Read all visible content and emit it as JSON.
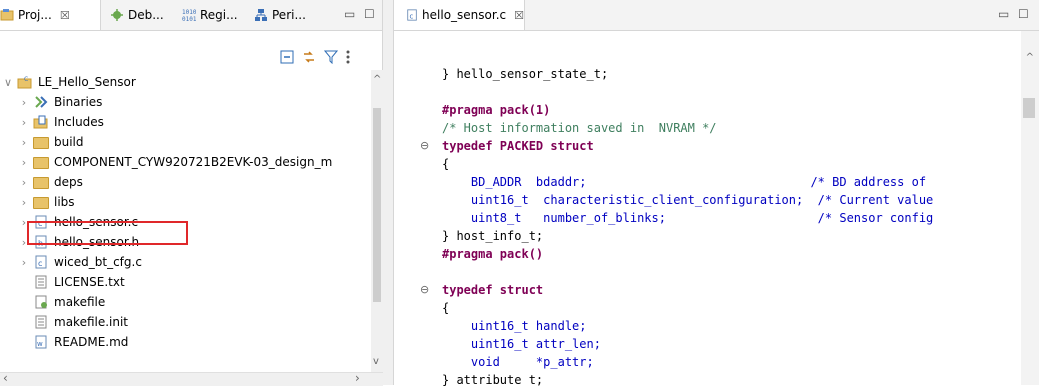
{
  "left_tabs": [
    {
      "label": "Proj...",
      "icon": "project-explorer-icon",
      "close": "☒"
    },
    {
      "label": "Deb...",
      "icon": "debug-icon"
    },
    {
      "label": "Regi...",
      "icon": "registers-icon"
    },
    {
      "label": "Peri...",
      "icon": "peripherals-icon"
    }
  ],
  "editor_tab": {
    "label": "hello_sensor.c",
    "close": "☒"
  },
  "tree": {
    "project": "LE_Hello_Sensor",
    "items": [
      {
        "label": "Binaries",
        "icon": "binaries-icon"
      },
      {
        "label": "Includes",
        "icon": "includes-icon"
      },
      {
        "label": "build",
        "icon": "folder-icon"
      },
      {
        "label": "COMPONENT_CYW920721B2EVK-03_design_m",
        "icon": "folder-icon"
      },
      {
        "label": "deps",
        "icon": "folder-icon"
      },
      {
        "label": "libs",
        "icon": "folder-icon"
      },
      {
        "label": "hello_sensor.c",
        "icon": "c-file-icon"
      },
      {
        "label": "hello_sensor.h",
        "icon": "h-file-icon"
      },
      {
        "label": "wiced_bt_cfg.c",
        "icon": "c-file-icon"
      },
      {
        "label": "LICENSE.txt",
        "icon": "text-file-icon"
      },
      {
        "label": "makefile",
        "icon": "makefile-icon"
      },
      {
        "label": "makefile.init",
        "icon": "text-file-icon"
      },
      {
        "label": "README.md",
        "icon": "markdown-file-icon"
      }
    ]
  },
  "code_lines": [
    "} hello_sensor_state_t;",
    "",
    "#pragma pack(1)",
    "/* Host information saved in  NVRAM */",
    "typedef PACKED struct",
    "{",
    "    BD_ADDR  bdaddr;                               /* BD address of",
    "    uint16_t  characteristic_client_configuration;  /* Current value",
    "    uint8_t   number_of_blinks;                     /* Sensor config",
    "} host_info_t;",
    "#pragma pack()",
    "",
    "typedef struct",
    "{",
    "    uint16_t handle;",
    "    uint16_t attr_len;",
    "    void     *p_attr;",
    "} attribute t;"
  ],
  "colors": {
    "keyword": "#7f0055",
    "comment": "#3f7f5f",
    "highlight_box": "#e0282a"
  }
}
